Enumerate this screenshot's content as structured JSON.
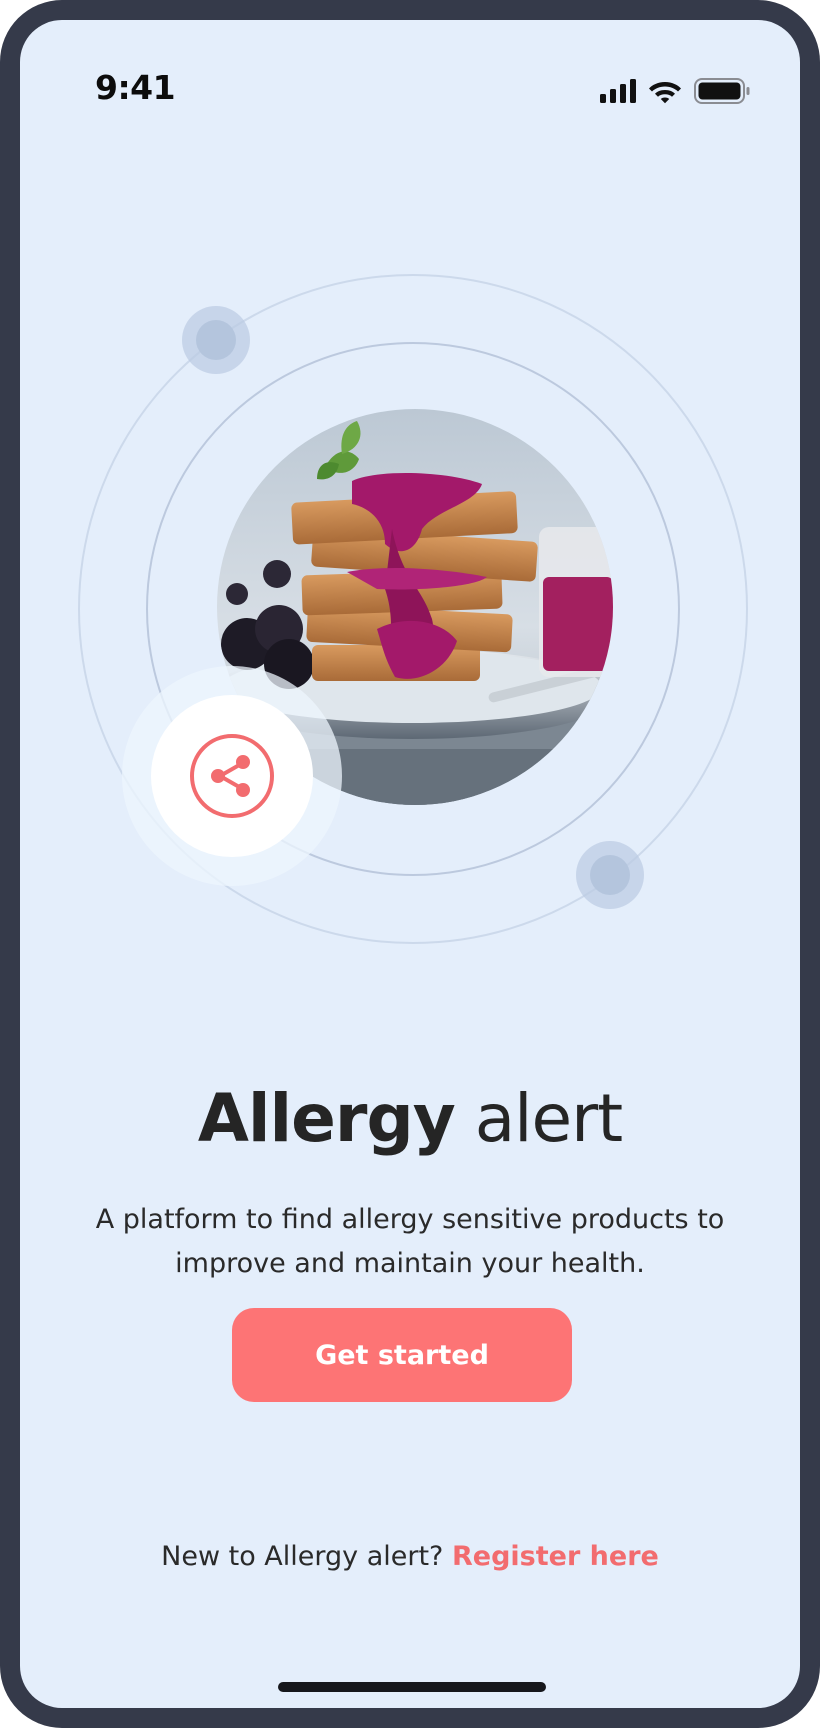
{
  "status_bar": {
    "time": "9:41",
    "signal_icon": "cellular-signal-icon",
    "wifi_icon": "wifi-icon",
    "battery_icon": "battery-icon"
  },
  "hero": {
    "image": "waffle-stack-with-berry-jam-image",
    "share_icon": "share-icon"
  },
  "welcome": {
    "title_strong": "Allergy",
    "title_light": "alert",
    "description": "A platform to find allergy sensitive products to improve and maintain your health."
  },
  "actions": {
    "primary_label": "Get started"
  },
  "footer": {
    "prompt": "New to Allergy alert?",
    "link_label": "Register here"
  },
  "colors": {
    "background": "#e4eefb",
    "frame": "#353a4a",
    "accent": "#fd7475",
    "link": "#f26c6f",
    "text": "#252525"
  }
}
